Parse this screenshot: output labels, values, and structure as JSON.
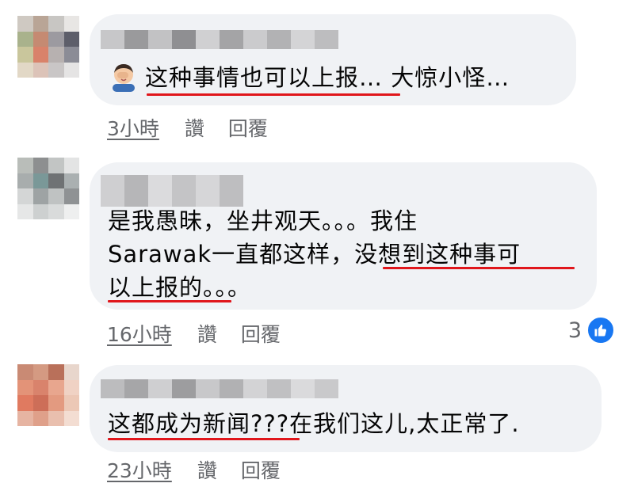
{
  "comments": [
    {
      "lines": [
        "这种事情也可以上报… 大惊小怪…"
      ],
      "time": "3小時",
      "like_label": "讚",
      "reply_label": "回覆",
      "emoji": "facepalm-emoji"
    },
    {
      "lines": [
        "是我愚昧，坐井观天。。。我住",
        "Sarawak一直都这样，没想到这种事可",
        "以上报的。。。"
      ],
      "time": "16小時",
      "like_label": "讚",
      "reply_label": "回覆",
      "reaction_count": "3",
      "reaction_icon": "thumbs-up-icon"
    },
    {
      "lines": [
        "这都成为新闻???在我们这儿,太正常了."
      ],
      "time": "23小時",
      "like_label": "讚",
      "reply_label": "回覆"
    }
  ],
  "colors": {
    "bubble": "#f0f2f5",
    "underline": "#e0161b",
    "meta": "#65676b",
    "like_blue": "#1877f2"
  }
}
